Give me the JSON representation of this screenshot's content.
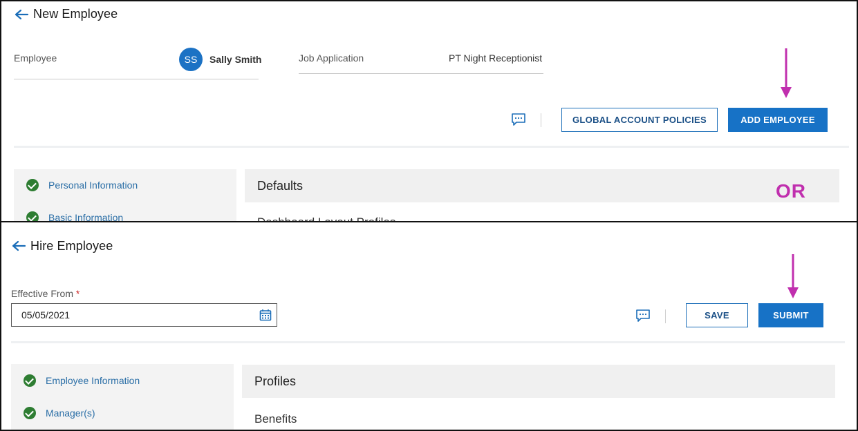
{
  "top_screen": {
    "title": "New Employee",
    "employee_label": "Employee",
    "employee_initials": "SS",
    "employee_name": "Sally Smith",
    "job_app_label": "Job Application",
    "job_app_value": "PT Night Receptionist",
    "global_policies_button": "GLOBAL ACCOUNT POLICIES",
    "add_employee_button": "ADD EMPLOYEE",
    "sidebar_items": [
      {
        "label": "Personal Information",
        "status": "complete"
      },
      {
        "label": "Basic Information",
        "status": "complete"
      }
    ],
    "section_title": "Defaults",
    "partial_text": "Dashboard Layout Profiles"
  },
  "or_label": "OR",
  "bottom_screen": {
    "title": "Hire Employee",
    "effective_from_label": "Effective From",
    "required_mark": "*",
    "effective_from_value": "05/05/2021",
    "save_button": "SAVE",
    "submit_button": "SUBMIT",
    "sidebar_items": [
      {
        "label": "Employee Information",
        "status": "complete"
      },
      {
        "label": "Manager(s)",
        "status": "complete"
      }
    ],
    "section_title": "Profiles",
    "body_item": "Benefits"
  },
  "colors": {
    "primary": "#1772c6",
    "annotation_arrow": "#c02fae",
    "check_green": "#2e7d32",
    "link_blue": "#2a6ea6"
  },
  "icons": [
    "back-arrow-icon",
    "comment-icon",
    "calendar-icon",
    "check-circle-icon",
    "annotation-arrow"
  ]
}
